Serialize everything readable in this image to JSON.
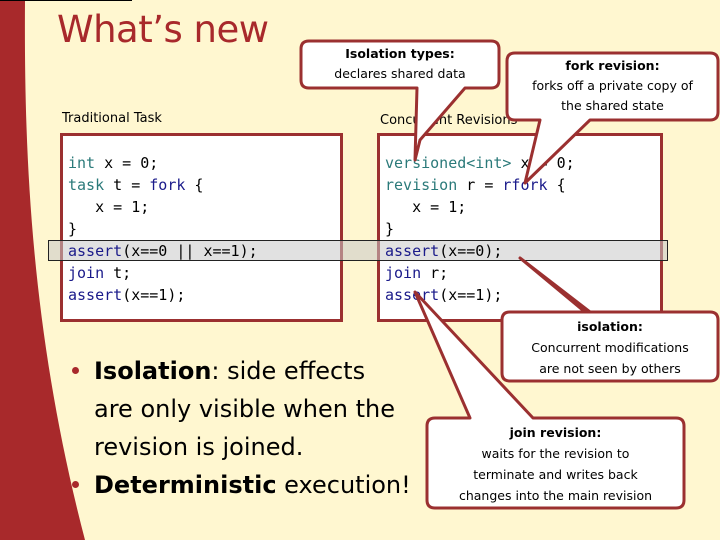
{
  "slide": {
    "title": "What’s new"
  },
  "traditional": {
    "heading": "Traditional Task",
    "code": [
      [
        {
          "t": "int",
          "c": "teal"
        },
        {
          "t": " x = 0;",
          "c": ""
        }
      ],
      [
        {
          "t": "task",
          "c": "teal"
        },
        {
          "t": " t = ",
          "c": ""
        },
        {
          "t": "fork",
          "c": "blue"
        },
        {
          "t": " {",
          "c": ""
        }
      ],
      [
        {
          "t": "   x = 1;",
          "c": ""
        }
      ],
      [
        {
          "t": "}",
          "c": ""
        }
      ],
      [
        {
          "t": "assert",
          "c": "blue"
        },
        {
          "t": "(x==0 || x==1);",
          "c": ""
        }
      ],
      [
        {
          "t": "join",
          "c": "blue"
        },
        {
          "t": " t;",
          "c": ""
        }
      ],
      [
        {
          "t": "assert",
          "c": "blue"
        },
        {
          "t": "(x==1);",
          "c": ""
        }
      ]
    ]
  },
  "concurrent": {
    "heading": "Concurrent Revisions",
    "code": [
      [
        {
          "t": "versioned<int>",
          "c": "teal"
        },
        {
          "t": " x = 0;",
          "c": ""
        }
      ],
      [
        {
          "t": "revision",
          "c": "teal"
        },
        {
          "t": " r = ",
          "c": ""
        },
        {
          "t": "rfork",
          "c": "blue"
        },
        {
          "t": " {",
          "c": ""
        }
      ],
      [
        {
          "t": "   x = 1;",
          "c": ""
        }
      ],
      [
        {
          "t": "}",
          "c": ""
        }
      ],
      [
        {
          "t": "assert",
          "c": "blue"
        },
        {
          "t": "(x==0);",
          "c": ""
        }
      ],
      [
        {
          "t": "join",
          "c": "blue"
        },
        {
          "t": " r;",
          "c": ""
        }
      ],
      [
        {
          "t": "assert",
          "c": "blue"
        },
        {
          "t": "(x==1);",
          "c": ""
        }
      ]
    ]
  },
  "callouts": {
    "isolation_types": {
      "title": "Isolation types:",
      "lines": [
        "declares shared data"
      ]
    },
    "fork_revision": {
      "title": "fork revision:",
      "lines": [
        "forks off a private copy of",
        "the shared state"
      ]
    },
    "isolation": {
      "title": "isolation:",
      "lines": [
        "Concurrent modifications",
        "are not seen by others"
      ]
    },
    "join_revision": {
      "title": "join revision:",
      "lines": [
        "waits for the revision to",
        "terminate and writes back",
        "changes into the main revision"
      ]
    }
  },
  "bullets": [
    {
      "bold": "Isolation",
      "rest": ": side effects",
      "cont": [
        "are only visible when the",
        "revision is joined."
      ]
    },
    {
      "bold": "Deterministic",
      "rest": " execution!",
      "cont": []
    }
  ],
  "colors": {
    "accent": "#a8292b",
    "border": "#9b3030",
    "background": "#fff7d0",
    "keyword_teal": "#2b7a7a",
    "keyword_blue": "#1a1a8a"
  }
}
